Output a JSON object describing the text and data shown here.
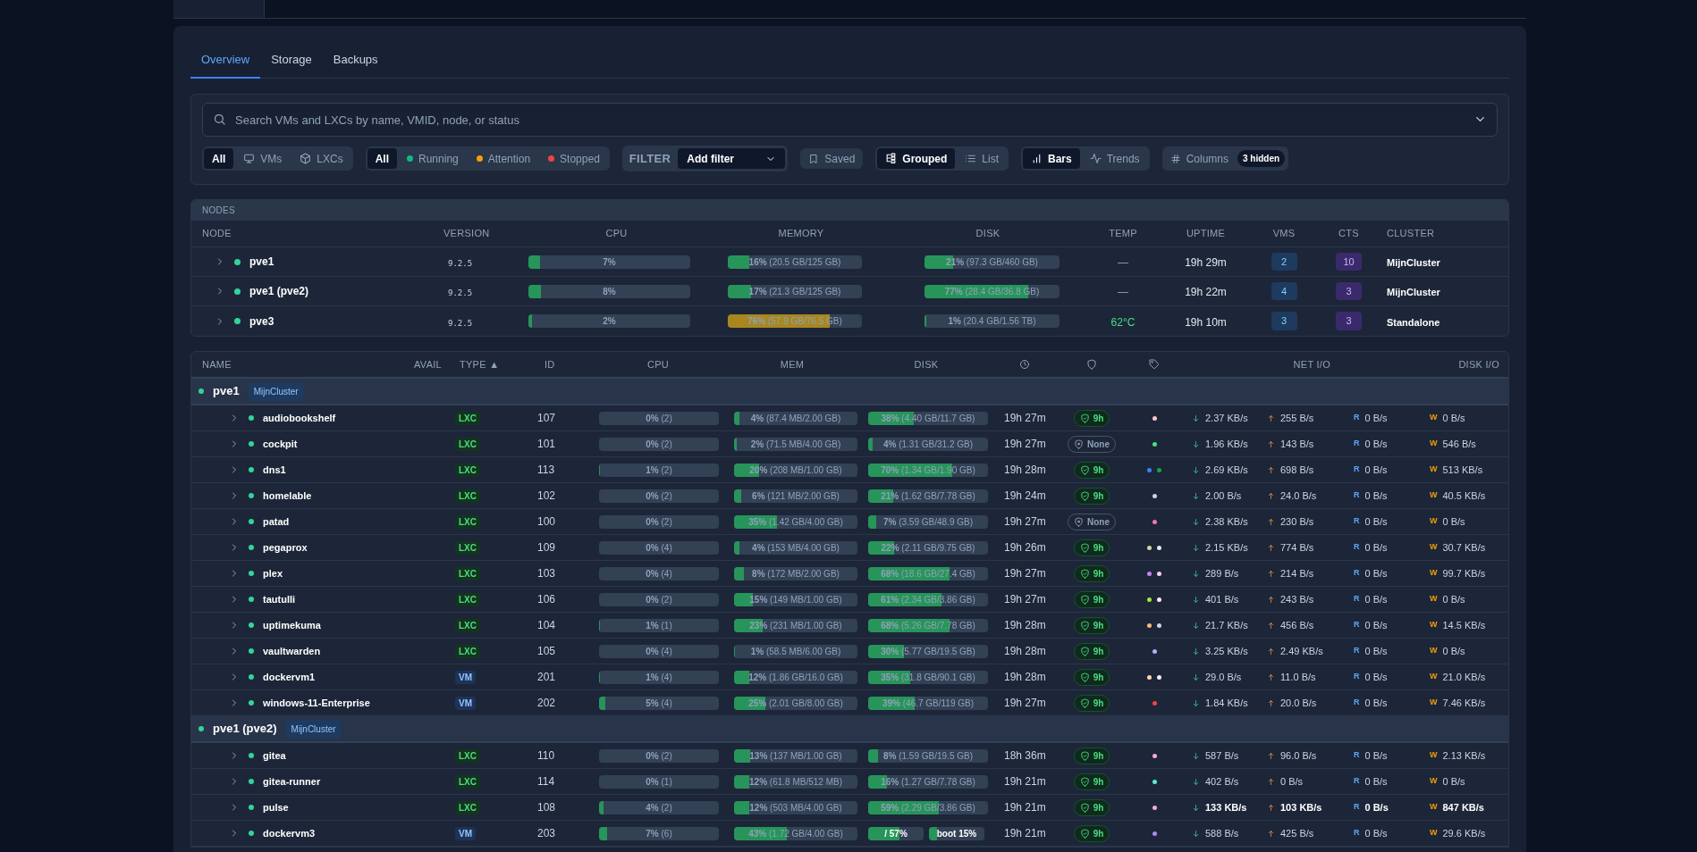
{
  "tabs": [
    {
      "label": "Overview",
      "selected": true
    },
    {
      "label": "Storage",
      "selected": false
    },
    {
      "label": "Backups",
      "selected": false
    }
  ],
  "search": {
    "placeholder": "Search VMs and LXCs by name, VMID, node, or status"
  },
  "type_filter": [
    {
      "label": "All",
      "kind": "all",
      "selected": true
    },
    {
      "label": "VMs",
      "kind": "vm",
      "selected": false
    },
    {
      "label": "LXCs",
      "kind": "lxc",
      "selected": false
    }
  ],
  "status_filter": [
    {
      "label": "All",
      "selected": true
    },
    {
      "label": "Running",
      "color": "#10b981",
      "selected": false
    },
    {
      "label": "Attention",
      "color": "#f59e0b",
      "selected": false
    },
    {
      "label": "Stopped",
      "color": "#ef4444",
      "selected": false
    }
  ],
  "filter": {
    "label": "FILTER",
    "value": "Add filter"
  },
  "saved": {
    "label": "Saved"
  },
  "view_mode": [
    {
      "label": "Grouped",
      "kind": "grouped",
      "selected": true
    },
    {
      "label": "List",
      "kind": "list",
      "selected": false
    }
  ],
  "chart_mode": [
    {
      "label": "Bars",
      "kind": "bars",
      "selected": true
    },
    {
      "label": "Trends",
      "kind": "trends",
      "selected": false
    }
  ],
  "columns_button": {
    "label": "Columns",
    "badge": "3 hidden"
  },
  "nodes": {
    "title": "NODES",
    "columns": [
      "NODE",
      "VERSION",
      "CPU",
      "MEMORY",
      "DISK",
      "TEMP",
      "UPTIME",
      "VMS",
      "CTS",
      "CLUSTER"
    ],
    "rows": [
      {
        "name": "pve1",
        "expanded": false,
        "online": true,
        "version": "9.2.5",
        "cpu": {
          "text": "**7%**",
          "level": 0.07,
          "warning": false
        },
        "memory": {
          "text": "**16%** (20.5 GB/125 GB)",
          "level": 0.16,
          "warning": false
        },
        "disk": {
          "text": "**21%** (97.3 GB/460 GB)",
          "level": 0.21,
          "warning": false
        },
        "temp": {
          "text": "—",
          "known": false
        },
        "uptime": "19h 29m",
        "vms": "2",
        "cts": "10",
        "cluster": "MijnCluster"
      },
      {
        "name": "pve1 (pve2)",
        "expanded": false,
        "online": true,
        "version": "9.2.5",
        "cpu": {
          "text": "**8%**",
          "level": 0.08,
          "warning": false
        },
        "memory": {
          "text": "**17%** (21.3 GB/125 GB)",
          "level": 0.17,
          "warning": false
        },
        "disk": {
          "text": "**77%** (28.4 GB/36.8 GB)",
          "level": 0.77,
          "warning": false
        },
        "temp": {
          "text": "—",
          "known": false
        },
        "uptime": "19h 22m",
        "vms": "4",
        "cts": "3",
        "cluster": "MijnCluster"
      },
      {
        "name": "pve3",
        "expanded": false,
        "online": true,
        "version": "9.2.5",
        "cpu": {
          "text": "**2%**",
          "level": 0.02,
          "warning": false
        },
        "memory": {
          "text": "**76%** (57.9 GB/76.5 GB)",
          "level": 0.76,
          "warning": true
        },
        "disk": {
          "text": "**1%** (20.4 GB/1.56 TB)",
          "level": 0.01,
          "warning": false
        },
        "temp": {
          "text": "62°C",
          "known": true
        },
        "uptime": "19h 10m",
        "vms": "3",
        "cts": "3",
        "cluster": "Standalone"
      }
    ]
  },
  "guests": {
    "columns": {
      "name": "NAME",
      "avail": "AVAIL",
      "type": "TYPE ▲",
      "id": "ID",
      "cpu": "CPU",
      "mem": "MEM",
      "disk": "DISK",
      "net": "NET I/O",
      "disk_io": "DISK I/O"
    },
    "groups": [
      {
        "node": "pve1",
        "online": true,
        "cluster": "MijnCluster",
        "rows": [
          {
            "name": "audiobookshelf",
            "running": true,
            "expanded": false,
            "type": "LXC",
            "kind": "lxc",
            "id": "107",
            "cpu": {
              "text": "**0%** (2)",
              "level": 0
            },
            "mem": {
              "text": "**4%** (87.4 MB/2.00 GB)",
              "level": 0.04
            },
            "disk": {
              "kind": "single",
              "text": "**38%** (4.40 GB/11.7 GB)",
              "level": 0.38
            },
            "uptime": "19h 27m",
            "backup": {
              "text": "9h",
              "ok": true
            },
            "tags": [
              {
                "color": "#fecaca"
              }
            ],
            "net_in": "2.37 KB/s",
            "net_out": "255 B/s",
            "disk_read": {
              "label": "R",
              "value": "0 B/s"
            },
            "disk_write": {
              "label": "W",
              "value": "0 B/s"
            },
            "highlight": false
          },
          {
            "name": "cockpit",
            "running": true,
            "expanded": false,
            "type": "LXC",
            "kind": "lxc",
            "id": "101",
            "cpu": {
              "text": "**0%** (2)",
              "level": 0
            },
            "mem": {
              "text": "**2%** (71.5 MB/4.00 GB)",
              "level": 0.02
            },
            "disk": {
              "kind": "single",
              "text": "**4%** (1.31 GB/31.2 GB)",
              "level": 0.04
            },
            "uptime": "19h 27m",
            "backup": {
              "text": "None",
              "ok": false
            },
            "tags": [
              {
                "color": "#4ade80"
              }
            ],
            "net_in": "1.96 KB/s",
            "net_out": "143 B/s",
            "disk_read": {
              "label": "R",
              "value": "0 B/s"
            },
            "disk_write": {
              "label": "W",
              "value": "546 B/s"
            },
            "highlight": false
          },
          {
            "name": "dns1",
            "running": true,
            "expanded": false,
            "type": "LXC",
            "kind": "lxc",
            "id": "113",
            "cpu": {
              "text": "**1%** (2)",
              "level": 0.01
            },
            "mem": {
              "text": "**20%** (208 MB/1.00 GB)",
              "level": 0.2
            },
            "disk": {
              "kind": "single",
              "text": "**70%** (1.34 GB/1.90 GB)",
              "level": 0.7
            },
            "uptime": "19h 28m",
            "backup": {
              "text": "9h",
              "ok": true
            },
            "tags": [
              {
                "color": "#3b82f6"
              },
              {
                "color": "#16a34a"
              }
            ],
            "net_in": "2.69 KB/s",
            "net_out": "698 B/s",
            "disk_read": {
              "label": "R",
              "value": "0 B/s"
            },
            "disk_write": {
              "label": "W",
              "value": "513 KB/s"
            },
            "highlight": false
          },
          {
            "name": "homelable",
            "running": true,
            "expanded": false,
            "type": "LXC",
            "kind": "lxc",
            "id": "102",
            "cpu": {
              "text": "**0%** (2)",
              "level": 0
            },
            "mem": {
              "text": "**6%** (121 MB/2.00 GB)",
              "level": 0.06
            },
            "disk": {
              "kind": "single",
              "text": "**21%** (1.62 GB/7.78 GB)",
              "level": 0.21
            },
            "uptime": "19h 24m",
            "backup": {
              "text": "9h",
              "ok": true
            },
            "tags": [
              {
                "color": "#cbd5e1"
              }
            ],
            "net_in": "2.00 B/s",
            "net_out": "24.0 B/s",
            "disk_read": {
              "label": "R",
              "value": "0 B/s"
            },
            "disk_write": {
              "label": "W",
              "value": "40.5 KB/s"
            },
            "highlight": false
          },
          {
            "name": "patad",
            "running": true,
            "expanded": false,
            "type": "LXC",
            "kind": "lxc",
            "id": "100",
            "cpu": {
              "text": "**0%** (2)",
              "level": 0
            },
            "mem": {
              "text": "**35%** (1.42 GB/4.00 GB)",
              "level": 0.35
            },
            "disk": {
              "kind": "single",
              "text": "**7%** (3.59 GB/48.9 GB)",
              "level": 0.07
            },
            "uptime": "19h 27m",
            "backup": {
              "text": "None",
              "ok": false
            },
            "tags": [
              {
                "color": "#f472b6"
              }
            ],
            "net_in": "2.38 KB/s",
            "net_out": "230 B/s",
            "disk_read": {
              "label": "R",
              "value": "0 B/s"
            },
            "disk_write": {
              "label": "W",
              "value": "0 B/s"
            },
            "highlight": false
          },
          {
            "name": "pegaprox",
            "running": true,
            "expanded": false,
            "type": "LXC",
            "kind": "lxc",
            "id": "109",
            "cpu": {
              "text": "**0%** (4)",
              "level": 0
            },
            "mem": {
              "text": "**4%** (153 MB/4.00 GB)",
              "level": 0.04
            },
            "disk": {
              "kind": "single",
              "text": "**22%** (2.11 GB/9.75 GB)",
              "level": 0.22
            },
            "uptime": "19h 26m",
            "backup": {
              "text": "9h",
              "ok": true
            },
            "tags": [
              {
                "color": "#d4d4a8"
              },
              {
                "color": "#e5e7eb"
              }
            ],
            "net_in": "2.15 KB/s",
            "net_out": "774 B/s",
            "disk_read": {
              "label": "R",
              "value": "0 B/s"
            },
            "disk_write": {
              "label": "W",
              "value": "30.7 KB/s"
            },
            "highlight": false
          },
          {
            "name": "plex",
            "running": true,
            "expanded": false,
            "type": "LXC",
            "kind": "lxc",
            "id": "103",
            "cpu": {
              "text": "**0%** (4)",
              "level": 0
            },
            "mem": {
              "text": "**8%** (172 MB/2.00 GB)",
              "level": 0.08
            },
            "disk": {
              "kind": "single",
              "text": "**68%** (18.6 GB/27.4 GB)",
              "level": 0.68
            },
            "uptime": "19h 27m",
            "backup": {
              "text": "9h",
              "ok": true
            },
            "tags": [
              {
                "color": "#c084fc"
              },
              {
                "color": "#fbcfe8"
              }
            ],
            "net_in": "289 B/s",
            "net_out": "214 B/s",
            "disk_read": {
              "label": "R",
              "value": "0 B/s"
            },
            "disk_write": {
              "label": "W",
              "value": "99.7 KB/s"
            },
            "highlight": false
          },
          {
            "name": "tautulli",
            "running": true,
            "expanded": false,
            "type": "LXC",
            "kind": "lxc",
            "id": "106",
            "cpu": {
              "text": "**0%** (2)",
              "level": 0
            },
            "mem": {
              "text": "**15%** (149 MB/1.00 GB)",
              "level": 0.15
            },
            "disk": {
              "kind": "single",
              "text": "**61%** (2.34 GB/3.86 GB)",
              "level": 0.61
            },
            "uptime": "19h 27m",
            "backup": {
              "text": "9h",
              "ok": true
            },
            "tags": [
              {
                "color": "#a3e635"
              },
              {
                "color": "#fce7f3"
              }
            ],
            "net_in": "401 B/s",
            "net_out": "243 B/s",
            "disk_read": {
              "label": "R",
              "value": "0 B/s"
            },
            "disk_write": {
              "label": "W",
              "value": "0 B/s"
            },
            "highlight": false
          },
          {
            "name": "uptimekuma",
            "running": true,
            "expanded": false,
            "type": "LXC",
            "kind": "lxc",
            "id": "104",
            "cpu": {
              "text": "**1%** (1)",
              "level": 0.01
            },
            "mem": {
              "text": "**23%** (231 MB/1.00 GB)",
              "level": 0.23
            },
            "disk": {
              "kind": "single",
              "text": "**68%** (5.26 GB/7.78 GB)",
              "level": 0.68
            },
            "uptime": "19h 28m",
            "backup": {
              "text": "9h",
              "ok": true
            },
            "tags": [
              {
                "color": "#fdba74"
              },
              {
                "color": "#d1d5db"
              }
            ],
            "net_in": "21.7 KB/s",
            "net_out": "456 B/s",
            "disk_read": {
              "label": "R",
              "value": "0 B/s"
            },
            "disk_write": {
              "label": "W",
              "value": "14.5 KB/s"
            },
            "highlight": false
          },
          {
            "name": "vaultwarden",
            "running": true,
            "expanded": false,
            "type": "LXC",
            "kind": "lxc",
            "id": "105",
            "cpu": {
              "text": "**0%** (4)",
              "level": 0
            },
            "mem": {
              "text": "**1%** (58.5 MB/6.00 GB)",
              "level": 0.01
            },
            "disk": {
              "kind": "single",
              "text": "**30%** (5.77 GB/19.5 GB)",
              "level": 0.3
            },
            "uptime": "19h 28m",
            "backup": {
              "text": "9h",
              "ok": true
            },
            "tags": [
              {
                "color": "#a5b4fc"
              }
            ],
            "net_in": "3.25 KB/s",
            "net_out": "2.49 KB/s",
            "disk_read": {
              "label": "R",
              "value": "0 B/s"
            },
            "disk_write": {
              "label": "W",
              "value": "0 B/s"
            },
            "highlight": false
          },
          {
            "name": "dockervm1",
            "running": true,
            "expanded": false,
            "type": "VM",
            "kind": "vm",
            "id": "201",
            "cpu": {
              "text": "**1%** (4)",
              "level": 0.01
            },
            "mem": {
              "text": "**12%** (1.86 GB/16.0 GB)",
              "level": 0.12
            },
            "disk": {
              "kind": "single",
              "text": "**35%** (31.8 GB/90.1 GB)",
              "level": 0.35
            },
            "uptime": "19h 28m",
            "backup": {
              "text": "9h",
              "ok": true
            },
            "tags": [
              {
                "color": "#fed7aa"
              },
              {
                "color": "#fce7f3"
              }
            ],
            "net_in": "29.0 B/s",
            "net_out": "11.0 B/s",
            "disk_read": {
              "label": "R",
              "value": "0 B/s"
            },
            "disk_write": {
              "label": "W",
              "value": "21.0 KB/s"
            },
            "highlight": false
          },
          {
            "name": "windows-11-Enterprise",
            "running": true,
            "expanded": false,
            "type": "VM",
            "kind": "vm",
            "id": "202",
            "cpu": {
              "text": "**5%** (4)",
              "level": 0.05
            },
            "mem": {
              "text": "**25%** (2.01 GB/8.00 GB)",
              "level": 0.25
            },
            "disk": {
              "kind": "single",
              "text": "**39%** (46.7 GB/119 GB)",
              "level": 0.39
            },
            "uptime": "19h 27m",
            "backup": {
              "text": "9h",
              "ok": true
            },
            "tags": [
              {
                "color": "#ef4444"
              }
            ],
            "net_in": "1.84 KB/s",
            "net_out": "20.0 B/s",
            "disk_read": {
              "label": "R",
              "value": "0 B/s"
            },
            "disk_write": {
              "label": "W",
              "value": "7.46 KB/s"
            },
            "highlight": false
          }
        ]
      },
      {
        "node": "pve1 (pve2)",
        "online": true,
        "cluster": "MijnCluster",
        "rows": [
          {
            "name": "gitea",
            "running": true,
            "expanded": false,
            "type": "LXC",
            "kind": "lxc",
            "id": "110",
            "cpu": {
              "text": "**0%** (2)",
              "level": 0
            },
            "mem": {
              "text": "**13%** (137 MB/1.00 GB)",
              "level": 0.13
            },
            "disk": {
              "kind": "single",
              "text": "**8%** (1.59 GB/19.5 GB)",
              "level": 0.08
            },
            "uptime": "18h 36m",
            "backup": {
              "text": "9h",
              "ok": true
            },
            "tags": [
              {
                "color": "#f9a8d4"
              }
            ],
            "net_in": "587 B/s",
            "net_out": "96.0 B/s",
            "disk_read": {
              "label": "R",
              "value": "0 B/s"
            },
            "disk_write": {
              "label": "W",
              "value": "2.13 KB/s"
            },
            "highlight": false
          },
          {
            "name": "gitea-runner",
            "running": true,
            "expanded": false,
            "type": "LXC",
            "kind": "lxc",
            "id": "114",
            "cpu": {
              "text": "**0%** (1)",
              "level": 0
            },
            "mem": {
              "text": "**12%** (61.8 MB/512 MB)",
              "level": 0.12
            },
            "disk": {
              "kind": "single",
              "text": "**16%** (1.27 GB/7.78 GB)",
              "level": 0.16
            },
            "uptime": "19h 21m",
            "backup": {
              "text": "9h",
              "ok": true
            },
            "tags": [
              {
                "color": "#5eead4"
              }
            ],
            "net_in": "402 B/s",
            "net_out": "0 B/s",
            "disk_read": {
              "label": "R",
              "value": "0 B/s"
            },
            "disk_write": {
              "label": "W",
              "value": "0 B/s"
            },
            "highlight": false
          },
          {
            "name": "pulse",
            "running": true,
            "expanded": false,
            "type": "LXC",
            "kind": "lxc",
            "id": "108",
            "cpu": {
              "text": "**4%** (2)",
              "level": 0.04
            },
            "mem": {
              "text": "**12%** (503 MB/4.00 GB)",
              "level": 0.12
            },
            "disk": {
              "kind": "single",
              "text": "**59%** (2.29 GB/3.86 GB)",
              "level": 0.59
            },
            "uptime": "19h 21m",
            "backup": {
              "text": "9h",
              "ok": true
            },
            "tags": [
              {
                "color": "#f9a8d4"
              }
            ],
            "net_in": "133 KB/s",
            "net_out": "103 KB/s",
            "disk_read": {
              "label": "R",
              "value": "0 B/s"
            },
            "disk_write": {
              "label": "W",
              "value": "847 KB/s"
            },
            "highlight": true
          },
          {
            "name": "dockervm3",
            "running": true,
            "expanded": false,
            "type": "VM",
            "kind": "vm",
            "id": "203",
            "cpu": {
              "text": "**7%** (6)",
              "level": 0.07
            },
            "mem": {
              "text": "**43%** (1.72 GB/4.00 GB)",
              "level": 0.43
            },
            "disk": {
              "kind": "split",
              "parts": [
                {
                  "text": "/ 57%",
                  "level": 0.57
                },
                {
                  "text": "boot 15%",
                  "level": 0.15
                }
              ]
            },
            "uptime": "19h 21m",
            "backup": {
              "text": "9h",
              "ok": true
            },
            "tags": [
              {
                "color": "#a78bfa"
              }
            ],
            "net_in": "588 B/s",
            "net_out": "425 B/s",
            "disk_read": {
              "label": "R",
              "value": "0 B/s"
            },
            "disk_write": {
              "label": "W",
              "value": "29.6 KB/s"
            },
            "highlight": false
          }
        ]
      }
    ]
  }
}
